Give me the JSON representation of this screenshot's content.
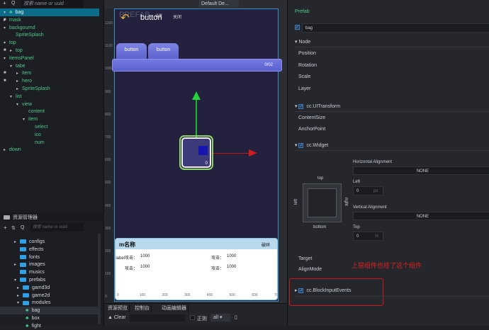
{
  "hierarchy": {
    "search_placeholder": "搜索 name or uuid",
    "nodes": [
      {
        "label": "bag",
        "depth": 0,
        "expanded": true,
        "selected": true,
        "icon": "prefab-icon"
      },
      {
        "label": "mask",
        "depth": 0,
        "locked": true,
        "collapsed": true
      },
      {
        "label": "backgournd",
        "depth": 0,
        "expanded": true
      },
      {
        "label": "SpriteSplash",
        "depth": 1
      },
      {
        "label": "top",
        "depth": 0,
        "expanded": true
      },
      {
        "label": "top",
        "depth": 1,
        "locked": true,
        "collapsed": true
      },
      {
        "label": "itemsPanel",
        "depth": 0,
        "expanded": true
      },
      {
        "label": "tabe",
        "depth": 1,
        "expanded": true
      },
      {
        "label": "item",
        "depth": 2,
        "locked": true,
        "collapsed": true
      },
      {
        "label": "hero",
        "depth": 2,
        "locked": true,
        "collapsed": true
      },
      {
        "label": "SpriteSplash",
        "depth": 2,
        "collapsed": true
      },
      {
        "label": "list",
        "depth": 1,
        "expanded": true
      },
      {
        "label": "view",
        "depth": 2,
        "expanded": true
      },
      {
        "label": "content",
        "depth": 3
      },
      {
        "label": "item",
        "depth": 3,
        "expanded": true
      },
      {
        "label": "select",
        "depth": 4
      },
      {
        "label": "ico",
        "depth": 4
      },
      {
        "label": "num",
        "depth": 4
      },
      {
        "label": "down",
        "depth": 0,
        "collapsed": true
      }
    ]
  },
  "assets": {
    "title": "资源管理器",
    "search_placeholder": "搜索 name or uuid",
    "items": [
      {
        "label": "configs",
        "depth": 0,
        "type": "folder",
        "collapsed": true
      },
      {
        "label": "effects",
        "depth": 0,
        "type": "folder"
      },
      {
        "label": "fonts",
        "depth": 0,
        "type": "folder"
      },
      {
        "label": "images",
        "depth": 0,
        "type": "folder",
        "collapsed": true
      },
      {
        "label": "musics",
        "depth": 0,
        "type": "folder"
      },
      {
        "label": "prefabs",
        "depth": 0,
        "type": "folder",
        "expanded": true
      },
      {
        "label": "gamd3d",
        "depth": 1,
        "type": "folder",
        "collapsed": true
      },
      {
        "label": "game2d",
        "depth": 1,
        "type": "folder",
        "collapsed": true
      },
      {
        "label": "modules",
        "depth": 1,
        "type": "folder",
        "expanded": true
      },
      {
        "label": "bag",
        "depth": 2,
        "type": "prefab",
        "selected": true
      },
      {
        "label": "box",
        "depth": 2,
        "type": "prefab"
      },
      {
        "label": "fight",
        "depth": 2,
        "type": "prefab"
      }
    ]
  },
  "scene": {
    "toolbar_dropdown": "Default De...",
    "watermark": "PREFAB",
    "ruler": [
      "1200",
      "1100",
      "1000",
      "900",
      "800",
      "700",
      "600",
      "500",
      "400",
      "300",
      "200",
      "100",
      "0"
    ],
    "header_title": "button",
    "header_small": "设置",
    "close_label": "关闭",
    "tabs": [
      "button",
      "button"
    ],
    "counter": "0/02",
    "item_count": "0",
    "card": {
      "title": "m名称",
      "right": "破碎",
      "rows": [
        [
          "label攻击：",
          "1000",
          "攻击：",
          "1000"
        ],
        [
          "攻击：",
          "1000",
          "攻击：",
          "1000"
        ]
      ],
      "axis": [
        "0",
        "100",
        "200",
        "300",
        "400",
        "500",
        "600",
        "700"
      ]
    }
  },
  "console": {
    "tabs": [
      "资源预览",
      "控制台",
      "动画编辑器"
    ],
    "clear": "Clear",
    "regex": "正则",
    "level": "all"
  },
  "inspector": {
    "prefab": "Prefab",
    "node_name": "bag",
    "node_section": "Node",
    "node_props": [
      "Position",
      "Rotation",
      "Scale",
      "Layer"
    ],
    "uitransform": "cc.UITransform",
    "uitransform_props": [
      "ContentSize",
      "AnchorPoint"
    ],
    "widget": "cc.Widget",
    "h_align_label": "Horizontal Alignment",
    "h_align": "NONE",
    "left_label": "Left",
    "left_value": "0",
    "left_unit": "px",
    "v_align_label": "Vertical Alignment",
    "v_align": "NONE",
    "top_label": "Top",
    "top_value": "0",
    "top_unit": "%",
    "widget_top": "top",
    "widget_bottom": "bottom",
    "widget_left": "left",
    "widget_right": "right",
    "target": "Target",
    "alignmode": "AlignMode",
    "annotation": "上层组件也挂了这个组件",
    "annotation_color": "#e02020",
    "block": "cc.BlockInputEvents"
  }
}
